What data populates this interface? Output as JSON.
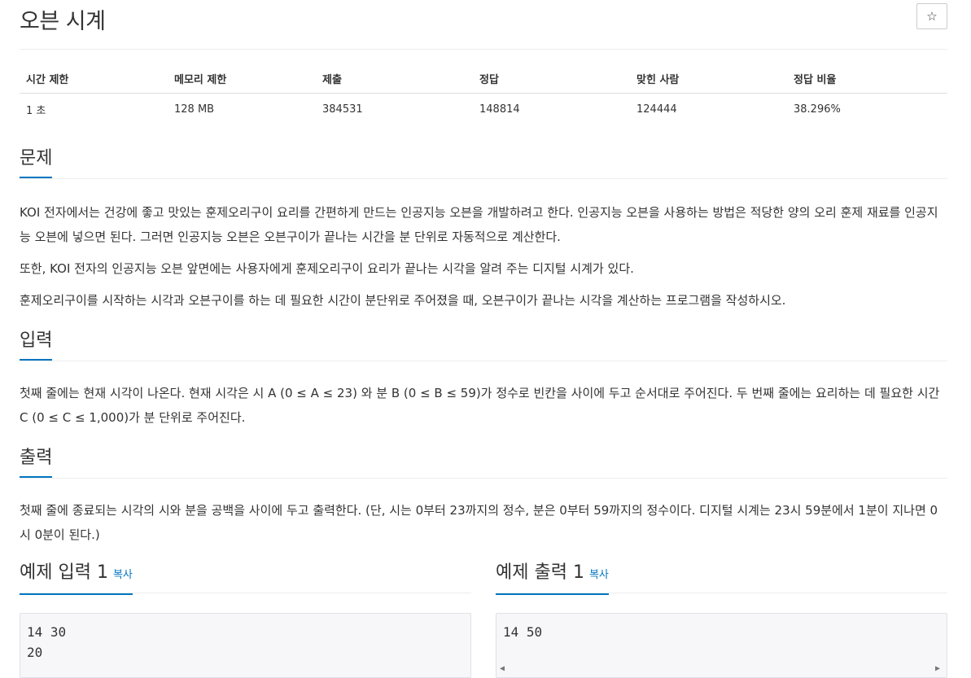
{
  "problem": {
    "title": "오븐 시계",
    "star_label": "☆"
  },
  "info_table": {
    "headers": [
      "시간 제한",
      "메모리 제한",
      "제출",
      "정답",
      "맞힌 사람",
      "정답 비율"
    ],
    "values": [
      "1 초",
      "128 MB",
      "384531",
      "148814",
      "124444",
      "38.296%"
    ]
  },
  "sections": {
    "description": {
      "title": "문제",
      "paragraphs": [
        "KOI 전자에서는 건강에 좋고 맛있는 훈제오리구이 요리를 간편하게 만드는 인공지능 오븐을 개발하려고 한다. 인공지능 오븐을 사용하는 방법은 적당한 양의 오리 훈제 재료를 인공지능 오븐에 넣으면 된다. 그러면 인공지능 오븐은 오븐구이가 끝나는 시간을 분 단위로 자동적으로 계산한다.",
        "또한, KOI 전자의 인공지능 오븐 앞면에는 사용자에게 훈제오리구이 요리가 끝나는 시각을 알려 주는 디지털 시계가 있다.",
        "훈제오리구이를 시작하는 시각과 오븐구이를 하는 데 필요한 시간이 분단위로 주어졌을 때, 오븐구이가 끝나는 시각을 계산하는 프로그램을 작성하시오."
      ]
    },
    "input": {
      "title": "입력",
      "text": "첫째 줄에는 현재 시각이 나온다. 현재 시각은 시 A (0 ≤ A ≤ 23) 와 분 B (0 ≤ B ≤ 59)가 정수로 빈칸을 사이에 두고 순서대로 주어진다. 두 번째 줄에는 요리하는 데 필요한 시간 C (0 ≤ C ≤ 1,000)가 분 단위로 주어진다."
    },
    "output": {
      "title": "출력",
      "text": "첫째 줄에 종료되는 시각의 시와 분을 공백을 사이에 두고 출력한다. (단, 시는 0부터 23까지의 정수, 분은 0부터 59까지의 정수이다. 디지털 시계는 23시 59분에서 1분이 지나면 0시 0분이 된다.)"
    }
  },
  "samples": {
    "input": {
      "title": "예제 입력 1",
      "copy_label": "복사",
      "lines": [
        "14 30",
        "20"
      ]
    },
    "output": {
      "title": "예제 출력 1",
      "copy_label": "복사",
      "lines": [
        "14 50"
      ]
    }
  }
}
